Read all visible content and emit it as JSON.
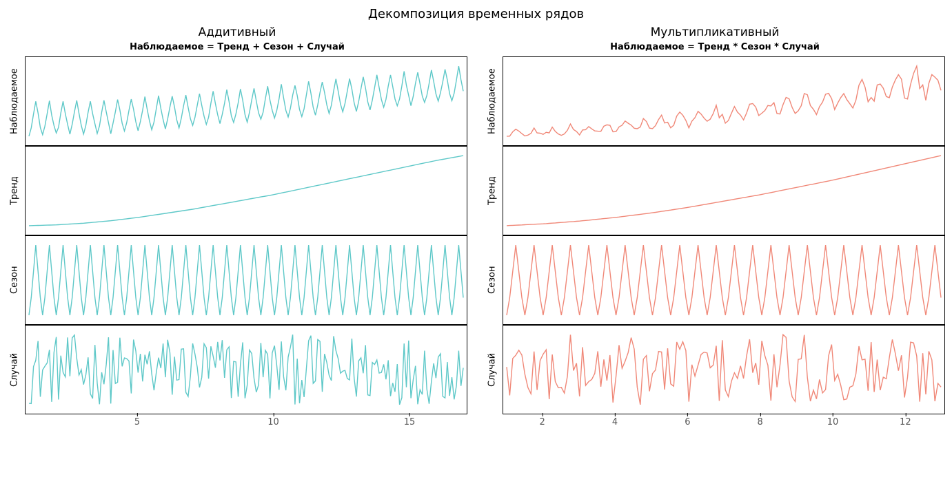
{
  "main_title": "Декомпозиция временных рядов",
  "left": {
    "title": "Аддитивный",
    "subtitle": "Наблюдаемое = Тренд + Сезон + Случай",
    "color": "#5ec8c8",
    "xticks": [
      5,
      10,
      15
    ],
    "xrange": [
      1,
      17
    ],
    "labels": {
      "observed": "Наблюдаемое",
      "trend": "Тренд",
      "seasonal": "Сезон",
      "random": "Случай"
    }
  },
  "right": {
    "title": "Мультипликативный",
    "subtitle": "Наблюдаемое = Тренд * Сезон * Случай",
    "color": "#f08878",
    "xticks": [
      2,
      4,
      6,
      8,
      10,
      12
    ],
    "xrange": [
      1,
      13
    ],
    "labels": {
      "observed": "Наблюдаемое",
      "trend": "Тренд",
      "seasonal": "Сезон",
      "random": "Случай"
    }
  },
  "chart_data": [
    {
      "id": "additive",
      "type": "line",
      "title": "Аддитивный",
      "xlabel": "",
      "ylabel_panels": [
        "Наблюдаемое",
        "Тренд",
        "Сезон",
        "Случай"
      ],
      "xrange": [
        1,
        17
      ],
      "period": 12,
      "n": 192,
      "series": {
        "trend_x": [
          1,
          2,
          3,
          4,
          5,
          6,
          7,
          8,
          9,
          10,
          11,
          12,
          13,
          14,
          15,
          16,
          17
        ],
        "trend_y": [
          10,
          10.5,
          11.5,
          13,
          15,
          17.5,
          20,
          23,
          26,
          29,
          32.5,
          36,
          39.5,
          43,
          46.5,
          50,
          53
        ],
        "seasonal_cycle": [
          -3,
          -1,
          2,
          5,
          2,
          -1,
          -3,
          -1,
          2,
          5,
          2,
          -1
        ],
        "random_example_x": [
          1,
          2,
          3,
          4,
          5,
          6,
          7,
          8,
          9,
          10,
          11,
          12,
          13,
          14,
          15,
          16,
          17
        ],
        "random_example_y": [
          0.2,
          -0.8,
          0.5,
          -0.3,
          0.9,
          -1.1,
          0.4,
          -0.2,
          1.2,
          -0.6,
          0.3,
          -0.9,
          0.7,
          -0.4,
          0.5,
          -0.7,
          0.1
        ],
        "observed_formula": "trend(x) + seasonal(x) + random(x)"
      }
    },
    {
      "id": "multiplicative",
      "type": "line",
      "title": "Мультипликативный",
      "xlabel": "",
      "ylabel_panels": [
        "Наблюдаемое",
        "Тренд",
        "Сезон",
        "Случай"
      ],
      "xrange": [
        1,
        13
      ],
      "period": 12,
      "n": 144,
      "series": {
        "trend_x": [
          1,
          2,
          3,
          4,
          5,
          6,
          7,
          8,
          9,
          10,
          11,
          12,
          13
        ],
        "trend_y": [
          10,
          11,
          12.5,
          14.5,
          17,
          20,
          23.5,
          27,
          31,
          35,
          39.5,
          44,
          48.5
        ],
        "seasonal_cycle": [
          0.8,
          0.9,
          1.05,
          1.2,
          1.05,
          0.9,
          0.8,
          0.9,
          1.05,
          1.2,
          1.05,
          0.9
        ],
        "random_example_x": [
          1,
          2,
          3,
          4,
          5,
          6,
          7,
          8,
          9,
          10,
          11,
          12,
          13
        ],
        "random_example_y": [
          1.02,
          0.95,
          1.04,
          0.97,
          1.06,
          0.92,
          1.03,
          0.98,
          1.08,
          0.94,
          1.01,
          0.93,
          1.05
        ],
        "observed_formula": "trend(x) * seasonal(x) * random(x)"
      }
    }
  ]
}
